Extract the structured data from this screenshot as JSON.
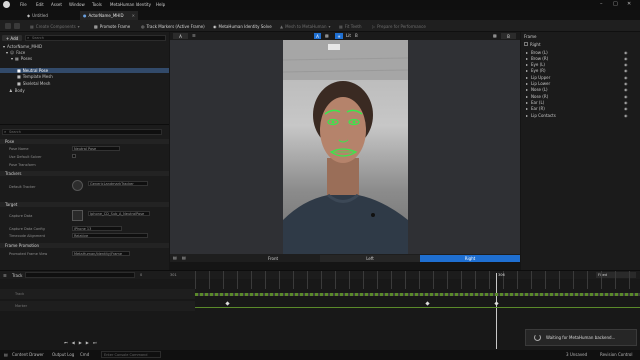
{
  "menubar": {
    "items": [
      "File",
      "Edit",
      "Asset",
      "Window",
      "Tools",
      "MetaHuman Identity",
      "Help"
    ],
    "window_title": "ActorName_MHID"
  },
  "tabs": {
    "untitled": "Untitled",
    "actor": "ActorName_MHID"
  },
  "toolbar": {
    "create_components": "Create Components",
    "promote_frame": "Promote Frame",
    "track_markers": "Track Markers (Active Frame)",
    "identity_solve": "MetaHuman Identity Solve",
    "mesh_to_metahuman": "Mesh to MetaHuman",
    "fit_teeth": "Fit Teeth",
    "prepare_performance": "Prepare for Performance"
  },
  "left_panel": {
    "add_label": "+ Add",
    "search_placeholder": "Search",
    "tree": [
      {
        "label": "ActorName_MHID",
        "indent": 0
      },
      {
        "label": "Face",
        "indent": 1
      },
      {
        "label": "Poses",
        "indent": 2
      },
      {
        "label": "Neutral Pose",
        "indent": 3,
        "selected": true
      },
      {
        "label": "Template Mesh",
        "indent": 3
      },
      {
        "label": "Skeletal Mesh",
        "indent": 3
      },
      {
        "label": "Body",
        "indent": 1
      }
    ],
    "details_search_placeholder": "Search",
    "sections": {
      "pose": "Pose",
      "trackers": "Trackers",
      "target": "Target",
      "frame_promotion": "Frame Promotion"
    },
    "props": {
      "pose_name": "Pose Name",
      "pose_name_value": "Neutral Pose",
      "use_default_solver": "Use Default Solver",
      "pose_transform": "Pose Transform",
      "default_tracker": "Default Tracker",
      "default_tracker_value": "GenericLandmarkTracker",
      "capture_data": "Capture Data",
      "capture_data_value": "Iphone_CD_Sub_A_NeutralPose",
      "capture_data_config": "Capture Data Config",
      "capture_data_config_value": "iPhone 13",
      "timecode_alignment": "Timecode Alignment",
      "timecode_alignment_value": "Relative",
      "promoted_frame_view": "Promoted Frame View",
      "promoted_frame_value": "MetaHuman/Identity/Frame"
    }
  },
  "viewport": {
    "left_badge": "A",
    "camera_a": "A",
    "camera_b": "B",
    "view_a": "A",
    "view_b": "B",
    "lit_label": "Lit",
    "footer": {
      "front": "Front",
      "left": "Left",
      "right": "Right"
    }
  },
  "right_panel": {
    "header": "Frame",
    "root": "Right",
    "items": [
      "Brow (L)",
      "Brow (R)",
      "Eye (L)",
      "Eye (R)",
      "Lip Upper",
      "Lip Lower",
      "Nose (L)",
      "Nose (R)",
      "Ear (L)",
      "Ear (R)",
      "Lip Contacts"
    ]
  },
  "timeline": {
    "track_label": "Track",
    "frame_start": "0",
    "frame_end": "301",
    "playhead": "306",
    "fps": "Fixed",
    "rows": [
      "Track",
      "Marker"
    ]
  },
  "statusbar": {
    "content_drawer": "Content Drawer",
    "output_log": "Output Log",
    "cmd": "Cmd",
    "console_placeholder": "Enter Console Command",
    "unsaved": "3 Unsaved",
    "revision": "Revision Control"
  },
  "toast": {
    "message": "Waiting for MetaHuman backend..."
  },
  "colors": {
    "accent": "#1f6fd1",
    "tracker": "#39e84b",
    "timeline_line": "#5a8a2a"
  }
}
